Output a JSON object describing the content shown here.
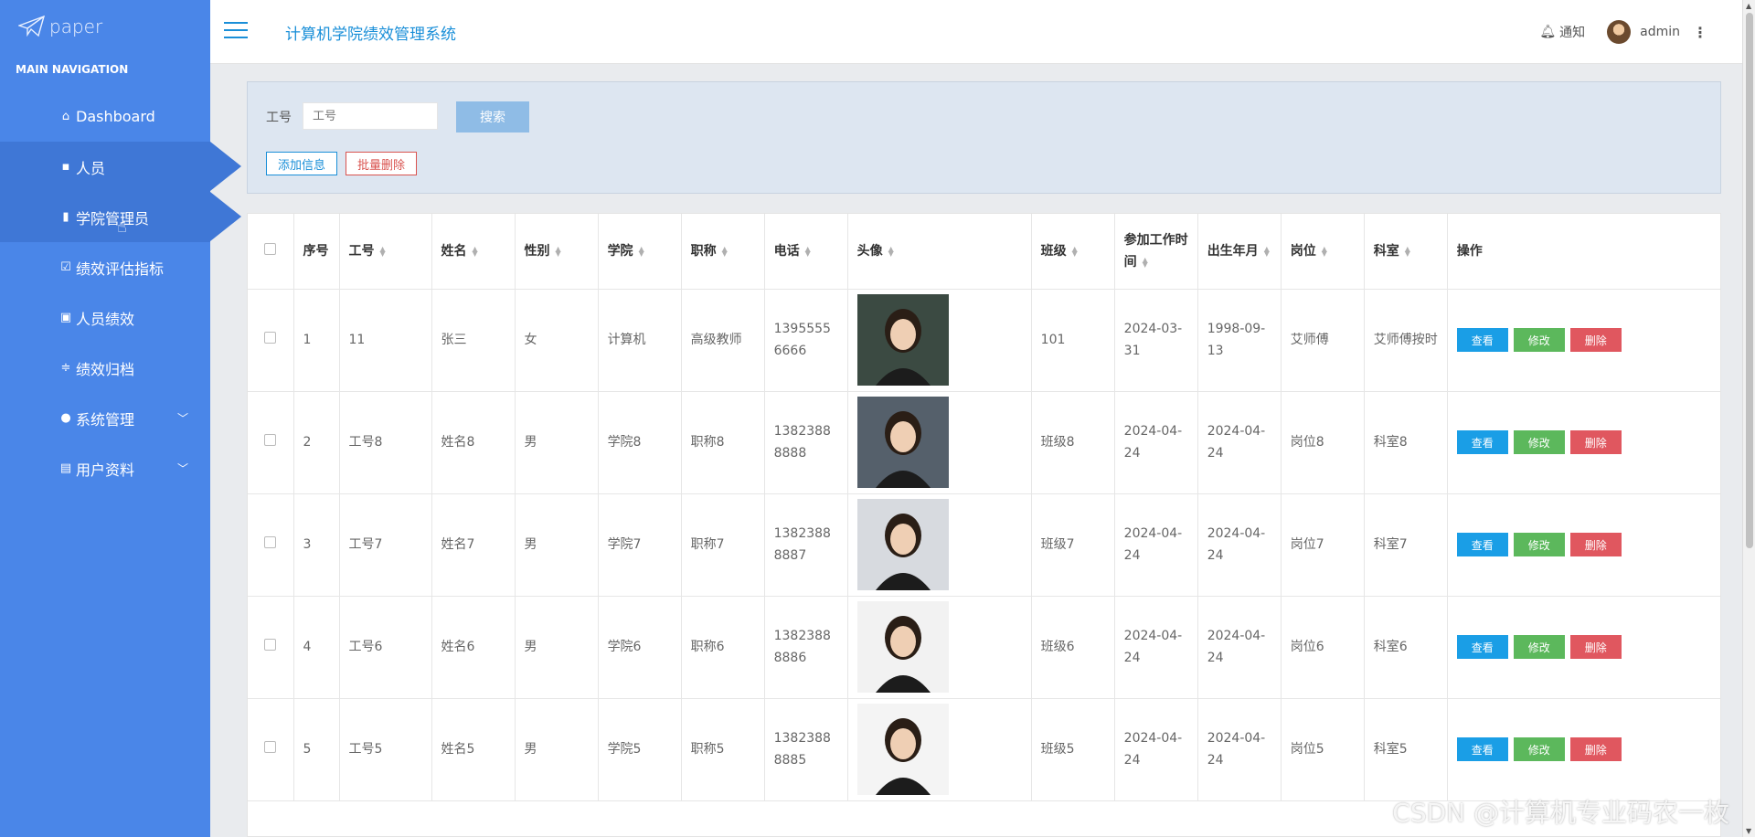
{
  "sidebar": {
    "logo": "paper",
    "nav_header": "MAIN NAVIGATION",
    "items": [
      {
        "label": "Dashboard",
        "icon": "home-icon"
      },
      {
        "label": "人员",
        "icon": "card-icon"
      },
      {
        "label": "学院管理员",
        "icon": "bar-chart-icon"
      },
      {
        "label": "绩效评估指标",
        "icon": "checkbox-icon"
      },
      {
        "label": "人员绩效",
        "icon": "clipboard-icon"
      },
      {
        "label": "绩效归档",
        "icon": "sliders-icon"
      },
      {
        "label": "系统管理",
        "icon": "user-icon"
      },
      {
        "label": "用户资料",
        "icon": "calendar-icon"
      }
    ]
  },
  "header": {
    "title": "计算机学院绩效管理系统",
    "notice": "通知",
    "user": "admin"
  },
  "search": {
    "label": "工号",
    "placeholder": "工号",
    "button": "搜索"
  },
  "actions": {
    "add": "添加信息",
    "batch_delete": "批量删除"
  },
  "table": {
    "headers": {
      "seq": "序号",
      "no": "工号",
      "name": "姓名",
      "gender": "性别",
      "college": "学院",
      "title": "职称",
      "phone": "电话",
      "avatar": "头像",
      "class": "班级",
      "work_date": "参加工作时间",
      "birth": "出生年月",
      "post": "岗位",
      "office": "科室",
      "ops": "操作"
    },
    "ops": {
      "view": "查看",
      "edit": "修改",
      "delete": "删除"
    },
    "rows": [
      {
        "seq": "1",
        "no": "11",
        "name": "张三",
        "gender": "女",
        "college": "计算机",
        "title": "高级教师",
        "phone": "13955556666",
        "class": "101",
        "work_date": "2024-03-31",
        "birth": "1998-09-13",
        "post": "艾师傅",
        "office": "艾师傅按时"
      },
      {
        "seq": "2",
        "no": "工号8",
        "name": "姓名8",
        "gender": "男",
        "college": "学院8",
        "title": "职称8",
        "phone": "13823888888",
        "class": "班级8",
        "work_date": "2024-04-24",
        "birth": "2024-04-24",
        "post": "岗位8",
        "office": "科室8"
      },
      {
        "seq": "3",
        "no": "工号7",
        "name": "姓名7",
        "gender": "男",
        "college": "学院7",
        "title": "职称7",
        "phone": "13823888887",
        "class": "班级7",
        "work_date": "2024-04-24",
        "birth": "2024-04-24",
        "post": "岗位7",
        "office": "科室7"
      },
      {
        "seq": "4",
        "no": "工号6",
        "name": "姓名6",
        "gender": "男",
        "college": "学院6",
        "title": "职称6",
        "phone": "13823888886",
        "class": "班级6",
        "work_date": "2024-04-24",
        "birth": "2024-04-24",
        "post": "岗位6",
        "office": "科室6"
      },
      {
        "seq": "5",
        "no": "工号5",
        "name": "姓名5",
        "gender": "男",
        "college": "学院5",
        "title": "职称5",
        "phone": "13823888885",
        "class": "班级5",
        "work_date": "2024-04-24",
        "birth": "2024-04-24",
        "post": "岗位5",
        "office": "科室5"
      }
    ]
  },
  "watermark": "CSDN @计算机专业码农一枚",
  "colors": {
    "sidebar": "#4a86e8",
    "accent": "#1a8fd8",
    "view": "#1a9ee6",
    "edit": "#5cb85c",
    "delete": "#e0575f"
  }
}
